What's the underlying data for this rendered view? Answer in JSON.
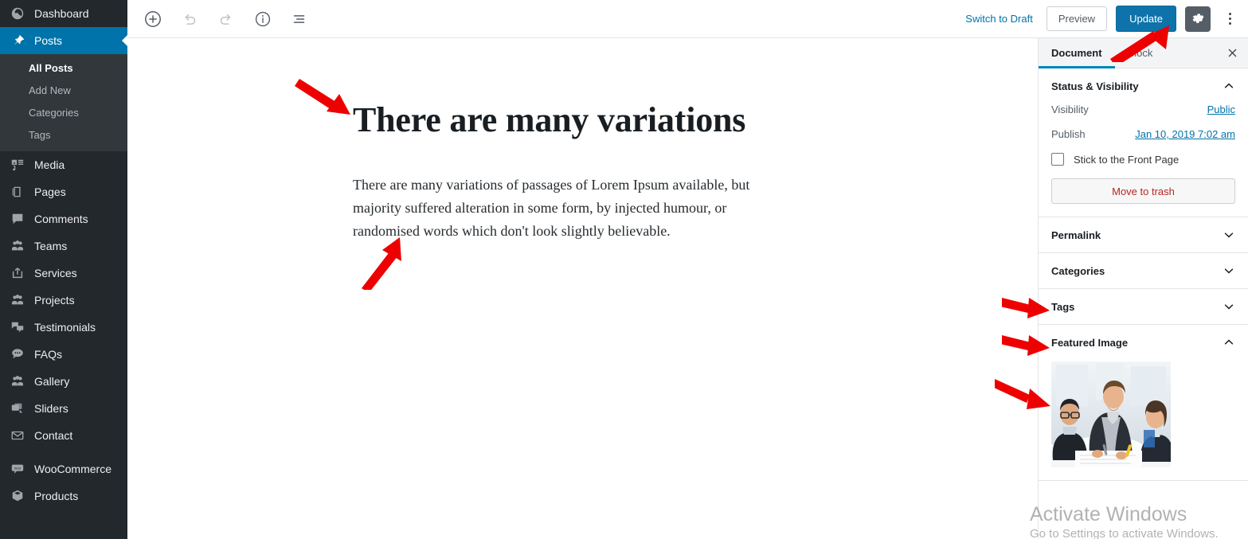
{
  "admin_menu": {
    "items": [
      {
        "label": "Dashboard",
        "icon": "dashboard-icon",
        "current": false
      },
      {
        "label": "Posts",
        "icon": "pin-icon",
        "current": true
      },
      {
        "label": "Media",
        "icon": "media-icon",
        "current": false
      },
      {
        "label": "Pages",
        "icon": "pages-icon",
        "current": false
      },
      {
        "label": "Comments",
        "icon": "comment-icon",
        "current": false
      },
      {
        "label": "Teams",
        "icon": "users-icon",
        "current": false
      },
      {
        "label": "Services",
        "icon": "external-icon",
        "current": false
      },
      {
        "label": "Projects",
        "icon": "users-icon",
        "current": false
      },
      {
        "label": "Testimonials",
        "icon": "testimonial-icon",
        "current": false
      },
      {
        "label": "FAQs",
        "icon": "chat-icon",
        "current": false
      },
      {
        "label": "Gallery",
        "icon": "users-icon",
        "current": false
      },
      {
        "label": "Sliders",
        "icon": "slides-icon",
        "current": false
      },
      {
        "label": "Contact",
        "icon": "envelope-icon",
        "current": false
      },
      {
        "label": "WooCommerce",
        "icon": "woocommerce-icon",
        "current": false
      },
      {
        "label": "Products",
        "icon": "product-box-icon",
        "current": false
      }
    ],
    "submenu": [
      {
        "label": "All Posts",
        "current": true
      },
      {
        "label": "Add New",
        "current": false
      },
      {
        "label": "Categories",
        "current": false
      },
      {
        "label": "Tags",
        "current": false
      }
    ],
    "colors": {
      "bg": "#23282d",
      "submenu_bg": "#32373c",
      "active": "#0073aa"
    }
  },
  "header": {
    "tools": [
      {
        "name": "add-block-icon",
        "title": "Add block"
      },
      {
        "name": "undo-icon",
        "title": "Undo"
      },
      {
        "name": "redo-icon",
        "title": "Redo"
      },
      {
        "name": "content-info-icon",
        "title": "Content structure"
      },
      {
        "name": "block-navigation-icon",
        "title": "Block navigation"
      }
    ],
    "switch_to_draft": "Switch to Draft",
    "preview": "Preview",
    "update": "Update",
    "settings_icon": "gear-icon",
    "more_icon": "vertical-ellipsis-icon",
    "accent": "#0e73aa"
  },
  "content": {
    "title": "There are many variations",
    "paragraph": "There are many variations of passages of Lorem Ipsum available, but majority suffered alteration in some form, by injected humour, or randomised words which don't look slightly believable."
  },
  "settings_sidebar": {
    "tabs": [
      {
        "label": "Document",
        "active": true
      },
      {
        "label": "Block",
        "active": false
      }
    ],
    "close_icon": "close-icon",
    "panels": [
      {
        "title": "Status & Visibility",
        "expanded": true,
        "rows": [
          {
            "label": "Visibility",
            "value": "Public"
          },
          {
            "label": "Publish",
            "value": "Jan 10, 2019 7:02 am"
          }
        ],
        "checkbox_label": "Stick to the Front Page",
        "checkbox_checked": false,
        "trash_label": "Move to trash"
      },
      {
        "title": "Permalink",
        "expanded": false
      },
      {
        "title": "Categories",
        "expanded": false
      },
      {
        "title": "Tags",
        "expanded": false
      },
      {
        "title": "Featured Image",
        "expanded": true
      }
    ]
  },
  "annotations": {
    "arrow_color": "#ee0000",
    "arrows": [
      {
        "target": "post-title",
        "direction": "down-right"
      },
      {
        "target": "post-paragraph",
        "direction": "up-right"
      },
      {
        "target": "update-button",
        "direction": "up-right"
      },
      {
        "target": "categories-panel",
        "direction": "right"
      },
      {
        "target": "tags-panel",
        "direction": "right"
      },
      {
        "target": "featured-image-panel",
        "direction": "down-right"
      }
    ]
  },
  "watermark": {
    "line1": "Activate Windows",
    "line2": "Go to Settings to activate Windows."
  }
}
